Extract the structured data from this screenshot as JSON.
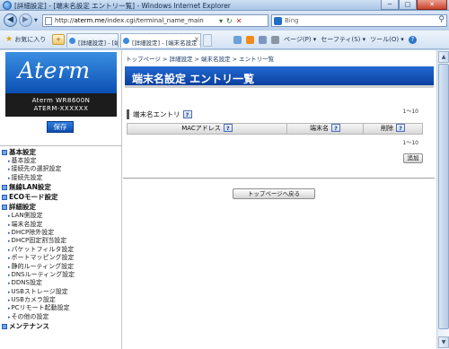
{
  "window": {
    "title": "[詳細設定] - [端末名設定 エントリ一覧] - Windows Internet Explorer",
    "min_label": "─",
    "max_label": "□",
    "close_label": "✕"
  },
  "addressbar": {
    "url_prefix": "http://",
    "url_host": "aterm.me",
    "url_path": "/index.cgi/terminal_name_main",
    "search_placeholder": "Bing"
  },
  "commandbar": {
    "favorites_label": "お気に入り",
    "tab1_label": "[詳細設定] - [端末名設定 エントリー...",
    "tab2_label": "[詳細設定] - [端末名設定 エントリ...",
    "page_menu": "ページ(P) ▾",
    "safety_menu": "セーフティ(S) ▾",
    "tools_menu": "ツール(O) ▾",
    "help_label": "?"
  },
  "sidebar": {
    "logo": "Aterm",
    "model_line1": "Aterm WR8600N",
    "model_line2": "ATERM-XXXXXX",
    "save_label": "保存",
    "sections": [
      {
        "title": "基本設定",
        "items": [
          "基本設定",
          "接続先の選択設定",
          "接続先設定"
        ]
      },
      {
        "title": "無線LAN設定",
        "items": []
      },
      {
        "title": "ECOモード設定",
        "items": []
      },
      {
        "title": "詳細設定",
        "items": [
          "LAN側設定",
          "端末名設定",
          "DHCP除外設定",
          "DHCP固定割当設定",
          "パケットフィルタ設定",
          "ポートマッピング設定",
          "静的ルーティング設定",
          "DNSルーティング設定",
          "DDNS設定",
          "USBストレージ設定",
          "USBカメラ設定",
          "PCリモート起動設定",
          "その他の設定"
        ]
      },
      {
        "title": "メンテナンス",
        "items": []
      }
    ]
  },
  "main": {
    "breadcrumb": "トップページ > 詳細設定 > 端末名設定 > エントリ一覧",
    "page_title": "端末名設定 エントリ一覧",
    "section_title": "端末名エントリ",
    "pager_top": "1～10",
    "pager_bottom": "1～10",
    "columns": [
      "MACアドレス",
      "端末名",
      "削除"
    ],
    "help_label": "?",
    "add_label": "追加",
    "back_label": "トップページへ戻る"
  }
}
